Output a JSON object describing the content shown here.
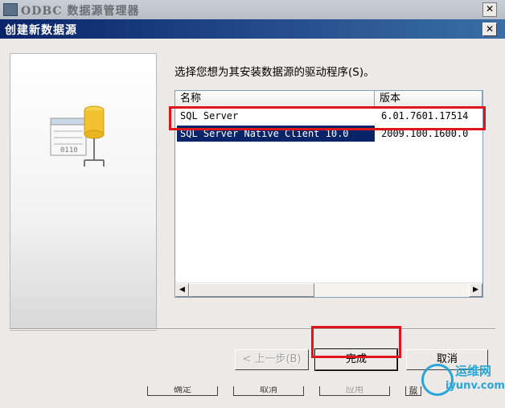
{
  "parent_window": {
    "title": "ODBC 数据源管理器",
    "close_glyph": "✕",
    "buttons_behind": [
      "确定",
      "取消",
      "应用",
      "帮助"
    ]
  },
  "dialog": {
    "title": "创建新数据源",
    "close_glyph": "✕",
    "instruction": "选择您想为其安装数据源的驱动程序(S)。",
    "columns": [
      "名称",
      "版本"
    ],
    "drivers": [
      {
        "name": "SQL Server",
        "version": "6.01.7601.17514"
      },
      {
        "name": "SQL Server Native Client 10.0",
        "version": "2009.100.1600.0"
      }
    ],
    "selected_driver": "SQL Server Native Client 10.0",
    "buttons": {
      "back": "< 上一步(B)",
      "finish": "完成",
      "cancel": "取消"
    },
    "scroll_left_glyph": "◀",
    "scroll_right_glyph": "▶"
  },
  "watermark": {
    "line1": "运维网",
    "line2": "iyunv.com"
  },
  "colors": {
    "title_bar": "#0a246a",
    "selection": "#0a246a",
    "annotation_red": "#e0151b",
    "watermark_blue": "#2aa6d6"
  },
  "icons": [
    "odbc-app-icon",
    "close-icon",
    "datasource-driver-icon",
    "scroll-left-icon",
    "scroll-right-icon"
  ]
}
